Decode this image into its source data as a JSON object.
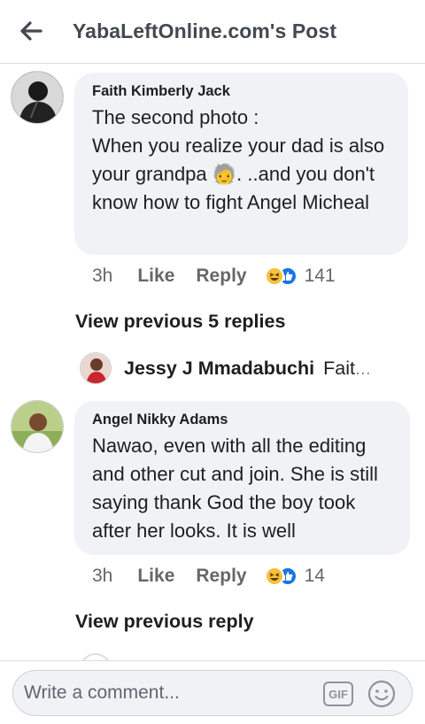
{
  "header": {
    "title": "YabaLeftOnline.com's Post",
    "back_icon": "arrow-left-icon"
  },
  "comments": [
    {
      "author": "Faith Kimberly Jack",
      "text": "The second photo :\nWhen you realize your dad is also your grandpa 🧓. ..and you don't know how to fight Angel Micheal",
      "time": "3h",
      "like_label": "Like",
      "reply_label": "Reply",
      "reaction_count": "141",
      "reactions": [
        "haha",
        "like"
      ]
    },
    {
      "author": "Angel Nikky Adams",
      "text": "Nawao, even with all the editing and other cut and join. She is still saying thank God the boy took after her looks. It is well",
      "time": "3h",
      "like_label": "Like",
      "reply_label": "Reply",
      "reaction_count": "14",
      "reactions": [
        "haha",
        "like"
      ]
    }
  ],
  "view_previous_1": "View previous 5 replies",
  "reply_preview": {
    "author": "Jessy J Mmadabuchi",
    "snippet": "Fait",
    "ellipsis": "..."
  },
  "view_previous_2": "View previous reply",
  "composer": {
    "placeholder": "Write a comment...",
    "gif_label": "GIF",
    "emoji_icon": "smiley-icon"
  },
  "colors": {
    "bubble": "#f0f2f5",
    "meta_text": "#65676b",
    "haha": "#f7c13a",
    "like": "#1b74e4"
  }
}
